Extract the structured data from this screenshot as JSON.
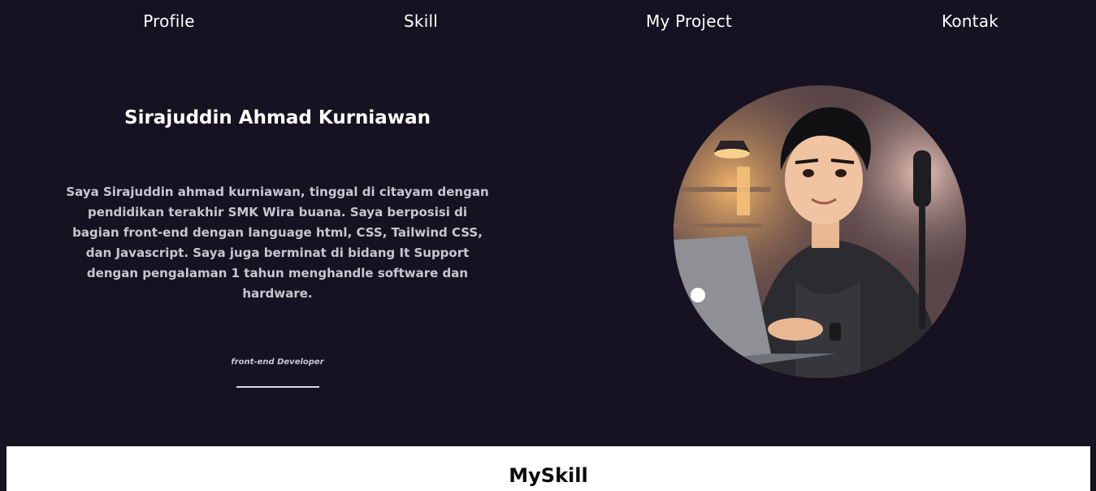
{
  "nav": {
    "items": [
      {
        "label": "Profile"
      },
      {
        "label": "Skill"
      },
      {
        "label": "My Project"
      },
      {
        "label": "Kontak"
      }
    ]
  },
  "hero": {
    "name": "Sirajuddin Ahmad Kurniawan",
    "description": "Saya Sirajuddin ahmad kurniawan, tinggal di citayam dengan pendidikan terakhir SMK Wira buana. Saya berposisi di bagian front-end dengan language html, CSS, Tailwind CSS, dan Javascript. Saya juga berminat di bidang It Support dengan pengalaman 1 tahun menghandle software dan hardware.",
    "role": "front-end Developer"
  },
  "skills": {
    "title": "MySkill"
  },
  "colors": {
    "background": "#161221",
    "text": "#ffffff",
    "muted_text": "#c9c6cf",
    "section_bg": "#ffffff"
  }
}
